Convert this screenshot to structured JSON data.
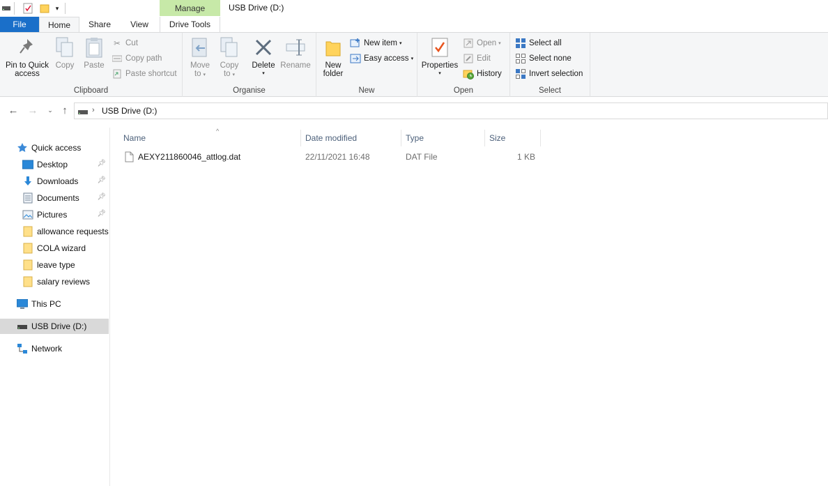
{
  "window": {
    "title": "USB Drive (D:)"
  },
  "ribbon_tabs": {
    "file": "File",
    "home": "Home",
    "share": "Share",
    "view": "View",
    "context_group": "Manage",
    "drive_tools": "Drive Tools"
  },
  "clipboard": {
    "label": "Clipboard",
    "pin_line1": "Pin to Quick",
    "pin_line2": "access",
    "copy": "Copy",
    "paste": "Paste",
    "cut": "Cut",
    "copy_path": "Copy path",
    "paste_shortcut": "Paste shortcut"
  },
  "organise": {
    "label": "Organise",
    "move_line1": "Move",
    "move_line2": "to",
    "copyto_line1": "Copy",
    "copyto_line2": "to",
    "delete": "Delete",
    "rename": "Rename"
  },
  "new_group": {
    "label": "New",
    "folder_line1": "New",
    "folder_line2": "folder",
    "new_item": "New item",
    "easy_access": "Easy access"
  },
  "open_group": {
    "label": "Open",
    "properties": "Properties",
    "open": "Open",
    "edit": "Edit",
    "history": "History"
  },
  "select_group": {
    "label": "Select",
    "select_all": "Select all",
    "select_none": "Select none",
    "invert": "Invert selection"
  },
  "address": {
    "path": "USB Drive (D:)"
  },
  "nav_pane": {
    "quick_access": "Quick access",
    "items": [
      {
        "label": "Desktop",
        "pinned": true
      },
      {
        "label": "Downloads",
        "pinned": true
      },
      {
        "label": "Documents",
        "pinned": true
      },
      {
        "label": "Pictures",
        "pinned": true
      },
      {
        "label": "allowance requests",
        "pinned": false
      },
      {
        "label": "COLA wizard",
        "pinned": false
      },
      {
        "label": "leave type",
        "pinned": false
      },
      {
        "label": "salary reviews",
        "pinned": false
      }
    ],
    "this_pc": "This PC",
    "usb_drive": "USB Drive (D:)",
    "network": "Network"
  },
  "file_list": {
    "columns": {
      "name": "Name",
      "date": "Date modified",
      "type": "Type",
      "size": "Size"
    },
    "rows": [
      {
        "name": "AEXY211860046_attlog.dat",
        "date": "22/11/2021 16:48",
        "type": "DAT File",
        "size": "1 KB"
      }
    ]
  },
  "colors": {
    "file_tab": "#1a6fc9",
    "manage_tab": "#c7e9a8",
    "selected_nav": "#d9d9d9",
    "header_text": "#4c607a"
  }
}
